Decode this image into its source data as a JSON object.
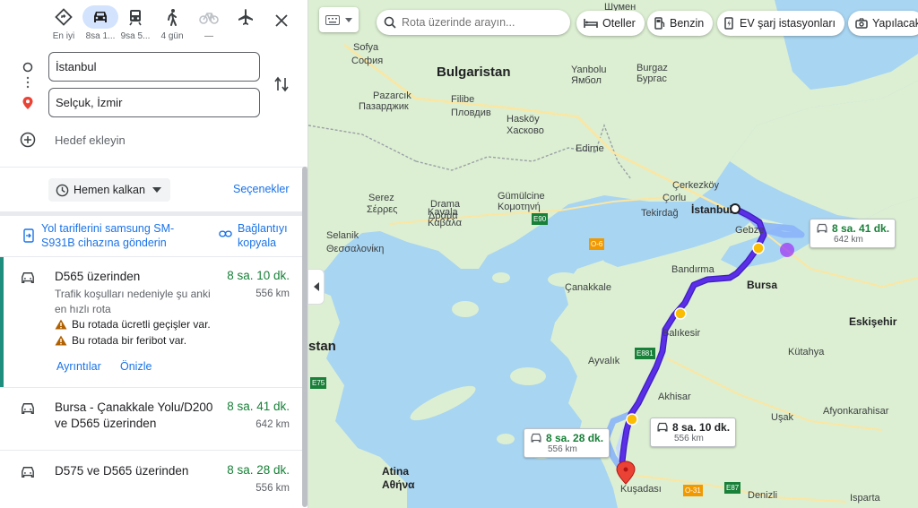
{
  "modes": [
    {
      "id": "best",
      "label": "En iyi"
    },
    {
      "id": "car",
      "label": "8sa 1..."
    },
    {
      "id": "transit",
      "label": "9sa 5..."
    },
    {
      "id": "walk",
      "label": "4 gün"
    },
    {
      "id": "bike",
      "label": "—"
    }
  ],
  "origin": {
    "value": "İstanbul"
  },
  "destination": {
    "value": "Selçuk, İzmir"
  },
  "add_destination": "Hedef ekleyin",
  "depart": "Hemen kalkan",
  "options": "Seçenekler",
  "send_to_device": "Yol tariflerini samsung SM-S931B cihazına gönderin",
  "copy_link": "Bağlantıyı kopyala",
  "routes": [
    {
      "name": "D565 üzerinden",
      "time": "8 sa. 10 dk.",
      "distance": "556 km",
      "description": "Trafik koşulları nedeniyle şu anki en hızlı rota",
      "warnings": [
        "Bu rotada ücretli geçişler var.",
        "Bu rotada bir feribot var."
      ],
      "details": "Ayrıntılar",
      "preview": "Önizle"
    },
    {
      "name": "Bursa - Çanakkale Yolu/D200 ve D565 üzerinden",
      "time": "8 sa. 41 dk.",
      "distance": "642 km"
    },
    {
      "name": "D575 ve D565 üzerinden",
      "time": "8 sa. 28 dk.",
      "distance": "556 km"
    }
  ],
  "map": {
    "search_placeholder": "Rota üzerinde arayın...",
    "chips": [
      "Oteller",
      "Benzin",
      "EV şarj istasyonları",
      "Yapılacak"
    ],
    "route_boxes": [
      {
        "time": "8 sa. 41 dk.",
        "distance": "642 km"
      },
      {
        "time": "8 sa. 10 dk.",
        "distance": "556 km"
      },
      {
        "time": "8 sa. 28 dk.",
        "distance": "556 km"
      }
    ],
    "labels": {
      "bulgaria": "Bulgaristan",
      "sofia": "Sofya",
      "sofia2": "София",
      "yambol": "Yanbolu",
      "yambol2": "Ямбол",
      "burgas": "Burgaz",
      "burgas2": "Бургас",
      "filibe": "Filibe",
      "filibe2": "Пловдив",
      "haskovo": "Hasköy",
      "haskovo2": "Хасково",
      "pazarcik": "Pazarcık",
      "pazarcik2": "Пазарджик",
      "shumen": "Шумен",
      "edirne": "Edirne",
      "cerkezkoy": "Çerkezköy",
      "corlu": "Çorlu",
      "istanbul": "İstanbul",
      "tekirdag": "Tekirdağ",
      "serez": "Serez",
      "serez2": "Σέρρες",
      "drama": "Drama",
      "drama2": "Δράμα",
      "kavala": "Kavala",
      "kavala2": "Καβάλα",
      "gumulcine": "Gümülcine",
      "gumulcine2": "Κομοτηνή",
      "selanik": "Selanik",
      "selanik2": "Θεσσαλονίκη",
      "gebze": "Gebze",
      "bandirma": "Bandırma",
      "bursa": "Bursa",
      "canakkale": "Çanakkale",
      "balikesir": "Balıkesir",
      "eskisehir": "Eskişehir",
      "kutahya": "Kütahya",
      "ayvalik": "Ayvalık",
      "akhisar": "Akhisar",
      "usak": "Uşak",
      "afyon": "Afyonkarahisar",
      "atina": "Atina",
      "atina2": "Αθήνα",
      "kusadasi": "Kuşadası",
      "denizli": "Denizli",
      "isparta": "Isparta",
      "stan": "stan",
      "e90": "E90",
      "e881": "E881",
      "e75": "E75",
      "e87": "E87",
      "o6": "O-6",
      "o31": "O-31"
    }
  },
  "colors": {
    "accent": "#1a73e8",
    "route_main": "#5b2ee8",
    "route_alt": "#8ab4f8",
    "time_green": "#188038",
    "land": "#dcefd2",
    "water": "#a8d5f2"
  }
}
